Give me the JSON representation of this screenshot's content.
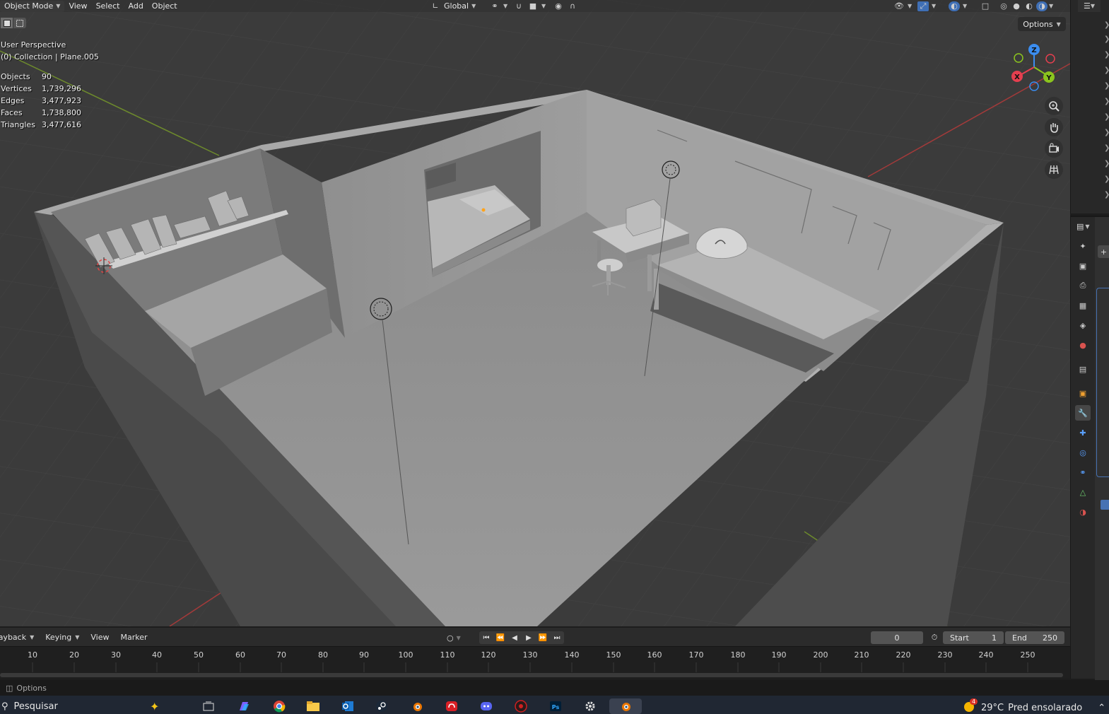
{
  "header": {
    "mode": "Object Mode",
    "menus": [
      "View",
      "Select",
      "Add",
      "Object"
    ],
    "transform_orientation": "Global"
  },
  "overlay": {
    "view_name": "User Perspective",
    "collection": "(0) Collection | Plane.005",
    "stats": [
      {
        "label": "Objects",
        "value": "90"
      },
      {
        "label": "Vertices",
        "value": "1,739,296"
      },
      {
        "label": "Edges",
        "value": "3,477,923"
      },
      {
        "label": "Faces",
        "value": "1,738,800"
      },
      {
        "label": "Triangles",
        "value": "3,477,616"
      }
    ]
  },
  "viewport": {
    "options_label": "Options",
    "gizmo_axes": {
      "x": "X",
      "y": "Y",
      "z": "Z"
    },
    "colors": {
      "x_axis": "#e53f4f",
      "y_axis": "#8bc41e",
      "z_axis": "#3b8df0",
      "background": "#3b3b3b"
    }
  },
  "timeline": {
    "menus": [
      "Playback",
      "Keying",
      "View",
      "Marker"
    ],
    "current_frame": "0",
    "start_label": "Start",
    "start_value": "1",
    "end_label": "End",
    "end_value": "250",
    "ruler_ticks": [
      "10",
      "20",
      "30",
      "40",
      "50",
      "60",
      "70",
      "80",
      "90",
      "100",
      "110",
      "120",
      "130",
      "140",
      "150",
      "160",
      "170",
      "180",
      "190",
      "200",
      "210",
      "220",
      "230",
      "240",
      "250"
    ]
  },
  "statusbar": {
    "options_label": "Options"
  },
  "taskbar": {
    "search_placeholder": "Pesquisar",
    "weather_temp": "29°C",
    "weather_desc": "Pred ensolarado",
    "weather_badge": "4",
    "apps": [
      "task-view",
      "copilot",
      "chrome",
      "file-explorer",
      "outlook",
      "steam",
      "blender",
      "creative-cloud",
      "discord",
      "davinci",
      "photoshop",
      "settings",
      "blender-active"
    ]
  }
}
